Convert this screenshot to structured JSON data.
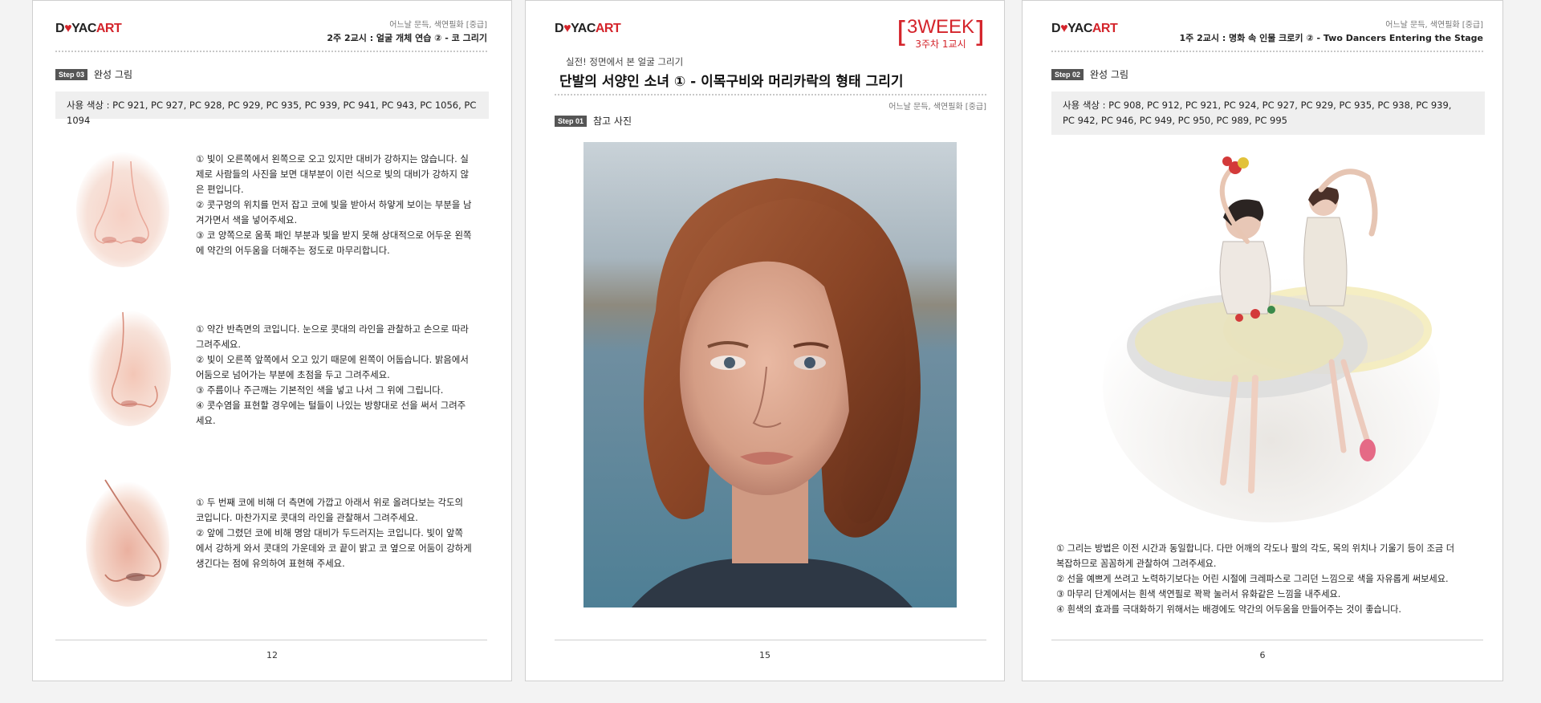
{
  "logo": {
    "dark": "D",
    "heart": "♥",
    "mid": "YAC",
    "red": "ART"
  },
  "left_page": {
    "top_small": "어느날 문득, 색연필화 [중급]",
    "title": "2주 2교시 : 얼굴 개체 연습 ② - 코 그리기",
    "step_badge": "Step 03",
    "step_label": "완성 그림",
    "colors": "사용 색상 :  PC 921, PC 927,  PC 928,  PC 929,  PC 935,  PC 939,  PC 941,  PC 943,  PC 1056,  PC 1094",
    "blocks": [
      {
        "lines": [
          "① 빛이 오른쪽에서 왼쪽으로 오고 있지만 대비가 강하지는 않습니다. 실",
          "제로 사람들의 사진을 보면 대부분이 이런 식으로 빛의 대비가 강하지 않",
          "은 편입니다.",
          "② 콧구멍의 위치를 먼저 잡고 코에 빛을 받아서 하얗게 보이는 부분을 남",
          "겨가면서 색을 넣어주세요.",
          "③ 코 양쪽으로 움푹 패인 부분과 빛을 받지 못해 상대적으로 어두운 왼쪽",
          "에 약간의 어두움을 더해주는 정도로 마무리합니다."
        ]
      },
      {
        "lines": [
          "① 약간 반측면의 코입니다. 눈으로 콧대의 라인을 관찰하고 손으로 따라",
          "그려주세요.",
          "② 빛이 오른쪽 앞쪽에서 오고 있기 때문에 왼쪽이 어둡습니다. 밝음에서",
          "어둠으로 넘어가는 부분에 초점을 두고 그려주세요.",
          "③ 주름이나 주근깨는 기본적인 색을 넣고 나서 그 위에 그립니다.",
          "④ 콧수염을 표현할 경우에는 털들이 나있는 방향대로 선을 써서 그려주",
          "세요."
        ]
      },
      {
        "lines": [
          "① 두 번째 코에 비해 더 측면에 가깝고 아래서 위로 올려다보는 각도의",
          "코입니다. 마찬가지로 콧대의 라인을 관찰해서 그려주세요.",
          "② 앞에 그렸던 코에 비해 명암 대비가 두드러지는 코입니다. 빛이 앞쪽",
          "에서 강하게 와서 콧대의 가운데와 코 끝이 밝고 코 옆으로 어둠이 강하게",
          "생긴다는 점에 유의하여 표현해 주세요."
        ]
      }
    ],
    "page_number": "12"
  },
  "middle_page": {
    "week_big": "3WEEK",
    "week_small": "3주차 1교시",
    "subtitle": "실전! 정면에서 본 얼굴 그리기",
    "title": "단발의 서양인 소녀 ① - 이목구비와 머리카락의 형태 그리기",
    "series": "어느날 문득, 색연필화 [중급]",
    "step_badge": "Step 01",
    "step_label": "참고 사진",
    "page_number": "15"
  },
  "right_page": {
    "top_small": "어느날 문득, 색연필화 [중급]",
    "title": "1주 2교시 : 명화 속 인물 크로키 ② - Two Dancers Entering the Stage",
    "step_badge": "Step 02",
    "step_label": "완성 그림",
    "colors_lines": [
      "사용 색상 :  PC 908,  PC 912,  PC 921,  PC 924,  PC 927,  PC 929,  PC 935,  PC 938,  PC 939,",
      "PC 942,  PC 946,  PC 949,  PC 950,  PC 989,  PC 995"
    ],
    "lines": [
      "① 그리는 방법은 이전 시간과 동일합니다. 다만 어깨의 각도나 팔의 각도, 목의 위치나 기울기 등이 조금 더",
      "복잡하므로 꼼꼼하게 관찰하여 그려주세요.",
      "② 선을 예쁘게 쓰려고 노력하기보다는 어린 시절에 크레파스로 그리던 느낌으로 색을 자유롭게 써보세요.",
      "③ 마무리 단계에서는 흰색 색연필로 꽉꽉 눌러서 유화같은 느낌을 내주세요.",
      "④ 흰색의 효과를 극대화하기 위해서는 배경에도 약간의 어두움을 만들어주는 것이 좋습니다."
    ],
    "page_number": "6"
  }
}
